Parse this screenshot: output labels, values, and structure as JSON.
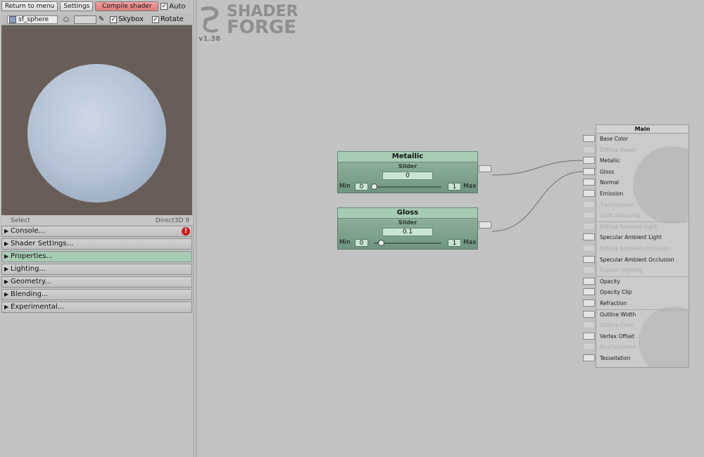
{
  "toolbar": {
    "return_label": "Return to menu",
    "settings_label": "Settings",
    "compile_label": "Compile shader",
    "auto_label": "Auto",
    "auto_checked": "✓"
  },
  "preview_bar": {
    "mesh_name": "sf_sphere",
    "circle_glyph": "○",
    "picker_glyph": "✎",
    "skybox_label": "Skybox",
    "skybox_checked": "✓",
    "rotate_label": "Rotate",
    "rotate_checked": "✓"
  },
  "status": {
    "select_label": "Select",
    "api_label": "Direct3D 9"
  },
  "sections": [
    {
      "label": "Console...",
      "glyph": "▶"
    },
    {
      "label": "Shader Settings...",
      "glyph": "▶"
    },
    {
      "label": "Properties...",
      "glyph": "▶"
    },
    {
      "label": "Lighting...",
      "glyph": "▶"
    },
    {
      "label": "Geometry...",
      "glyph": "▶"
    },
    {
      "label": "Blending...",
      "glyph": "▶"
    },
    {
      "label": "Experimental...",
      "glyph": "▶"
    }
  ],
  "warning_glyph": "!",
  "logo": {
    "line1": "SHADER",
    "line2": "FORGE",
    "version": "v1.38"
  },
  "nodes": [
    {
      "title": "Metallic",
      "type": "Slider",
      "value": "0",
      "min_label": "Min",
      "min": "0",
      "max_label": "Max",
      "max": "1",
      "fraction": 0.0
    },
    {
      "title": "Gloss",
      "type": "Slider",
      "value": "0.1",
      "min_label": "Min",
      "min": "0",
      "max_label": "Max",
      "max": "1",
      "fraction": 0.1
    }
  ],
  "main": {
    "title": "Main",
    "inputs": [
      {
        "label": "Base Color",
        "enabled": true
      },
      {
        "label": "Diffuse Power",
        "enabled": false
      },
      {
        "label": "Metallic",
        "enabled": true
      },
      {
        "label": "Gloss",
        "enabled": true
      },
      {
        "label": "Normal",
        "enabled": true
      },
      {
        "label": "Emission",
        "enabled": true
      },
      {
        "label": "Transmission",
        "enabled": false
      },
      {
        "label": "Light Wrapping",
        "enabled": false
      },
      {
        "label": "Diffuse Ambient Light",
        "enabled": false
      },
      {
        "label": "Specular Ambient Light",
        "enabled": true
      },
      {
        "label": "Diffuse Ambient Occlusion",
        "enabled": false
      },
      {
        "label": "Specular Ambient Occlusion",
        "enabled": true
      },
      {
        "label": "Custom Lighting",
        "enabled": false
      },
      {
        "label": "Opacity",
        "enabled": true
      },
      {
        "label": "Opacity Clip",
        "enabled": true
      },
      {
        "label": "Refraction",
        "enabled": true
      },
      {
        "label": "Outline Width",
        "enabled": true
      },
      {
        "label": "Outline Color",
        "enabled": false
      },
      {
        "label": "Vertex Offset",
        "enabled": true
      },
      {
        "label": "Displacement",
        "enabled": false
      },
      {
        "label": "Tessellation",
        "enabled": true
      }
    ]
  },
  "colors": {
    "accent_green": "#a6ccb4",
    "compile_red": "#e07878",
    "preview_bg": "#695e57"
  }
}
